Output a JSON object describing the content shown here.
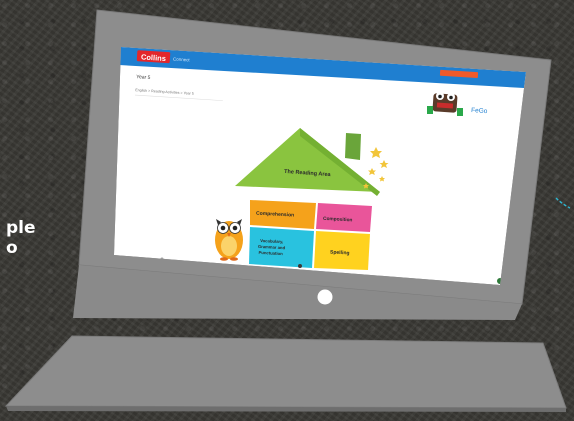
{
  "side_text": [
    "ple",
    "o"
  ],
  "site": {
    "brand": "Collins",
    "brand_sub": "Connect",
    "header_button": "",
    "page_title": "Year 5",
    "breadcrumb": "English > Reading Activities > Year 5",
    "mascot_label": "FeGo"
  },
  "house": {
    "roof_label": "The Reading Area",
    "rooms": [
      "Comprehension",
      "Composition",
      "Vocabulary, Grammar and Punctuation",
      "Spelling"
    ]
  },
  "colors": {
    "header_blue": "#1f7fd0",
    "brand_red": "#e3262b",
    "header_button": "#f05a2a",
    "roof_green": "#8ac43f",
    "room_orange": "#f5a21b",
    "room_pink": "#e9559a",
    "room_cyan": "#29c2df",
    "room_yellow": "#ffd21f",
    "laptop_grey": "#8d8d8d"
  },
  "icons": [
    "camera-icon",
    "monster-mascot-icon",
    "owl-mascot-icon",
    "stars-icon"
  ]
}
